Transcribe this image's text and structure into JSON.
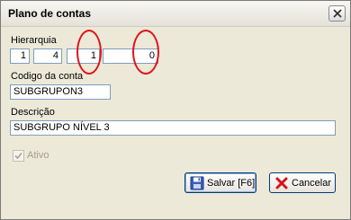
{
  "window": {
    "title": "Plano de contas"
  },
  "hierarquia": {
    "label": "Hierarquia",
    "levels": [
      "1",
      "4",
      "1",
      "0"
    ]
  },
  "codigo": {
    "label": "Codigo da conta",
    "value": "SUBGRUPON3"
  },
  "descricao": {
    "label": "Descrição",
    "value": "SUBGRUPO NÍVEL 3"
  },
  "ativo": {
    "label": "Ativo",
    "checked": true
  },
  "buttons": {
    "save_label": "Salvar [F6]",
    "cancel_label": "Cancelar"
  },
  "colors": {
    "highlight_ring": "#e0141b",
    "window_bg": "#ece9d8"
  }
}
